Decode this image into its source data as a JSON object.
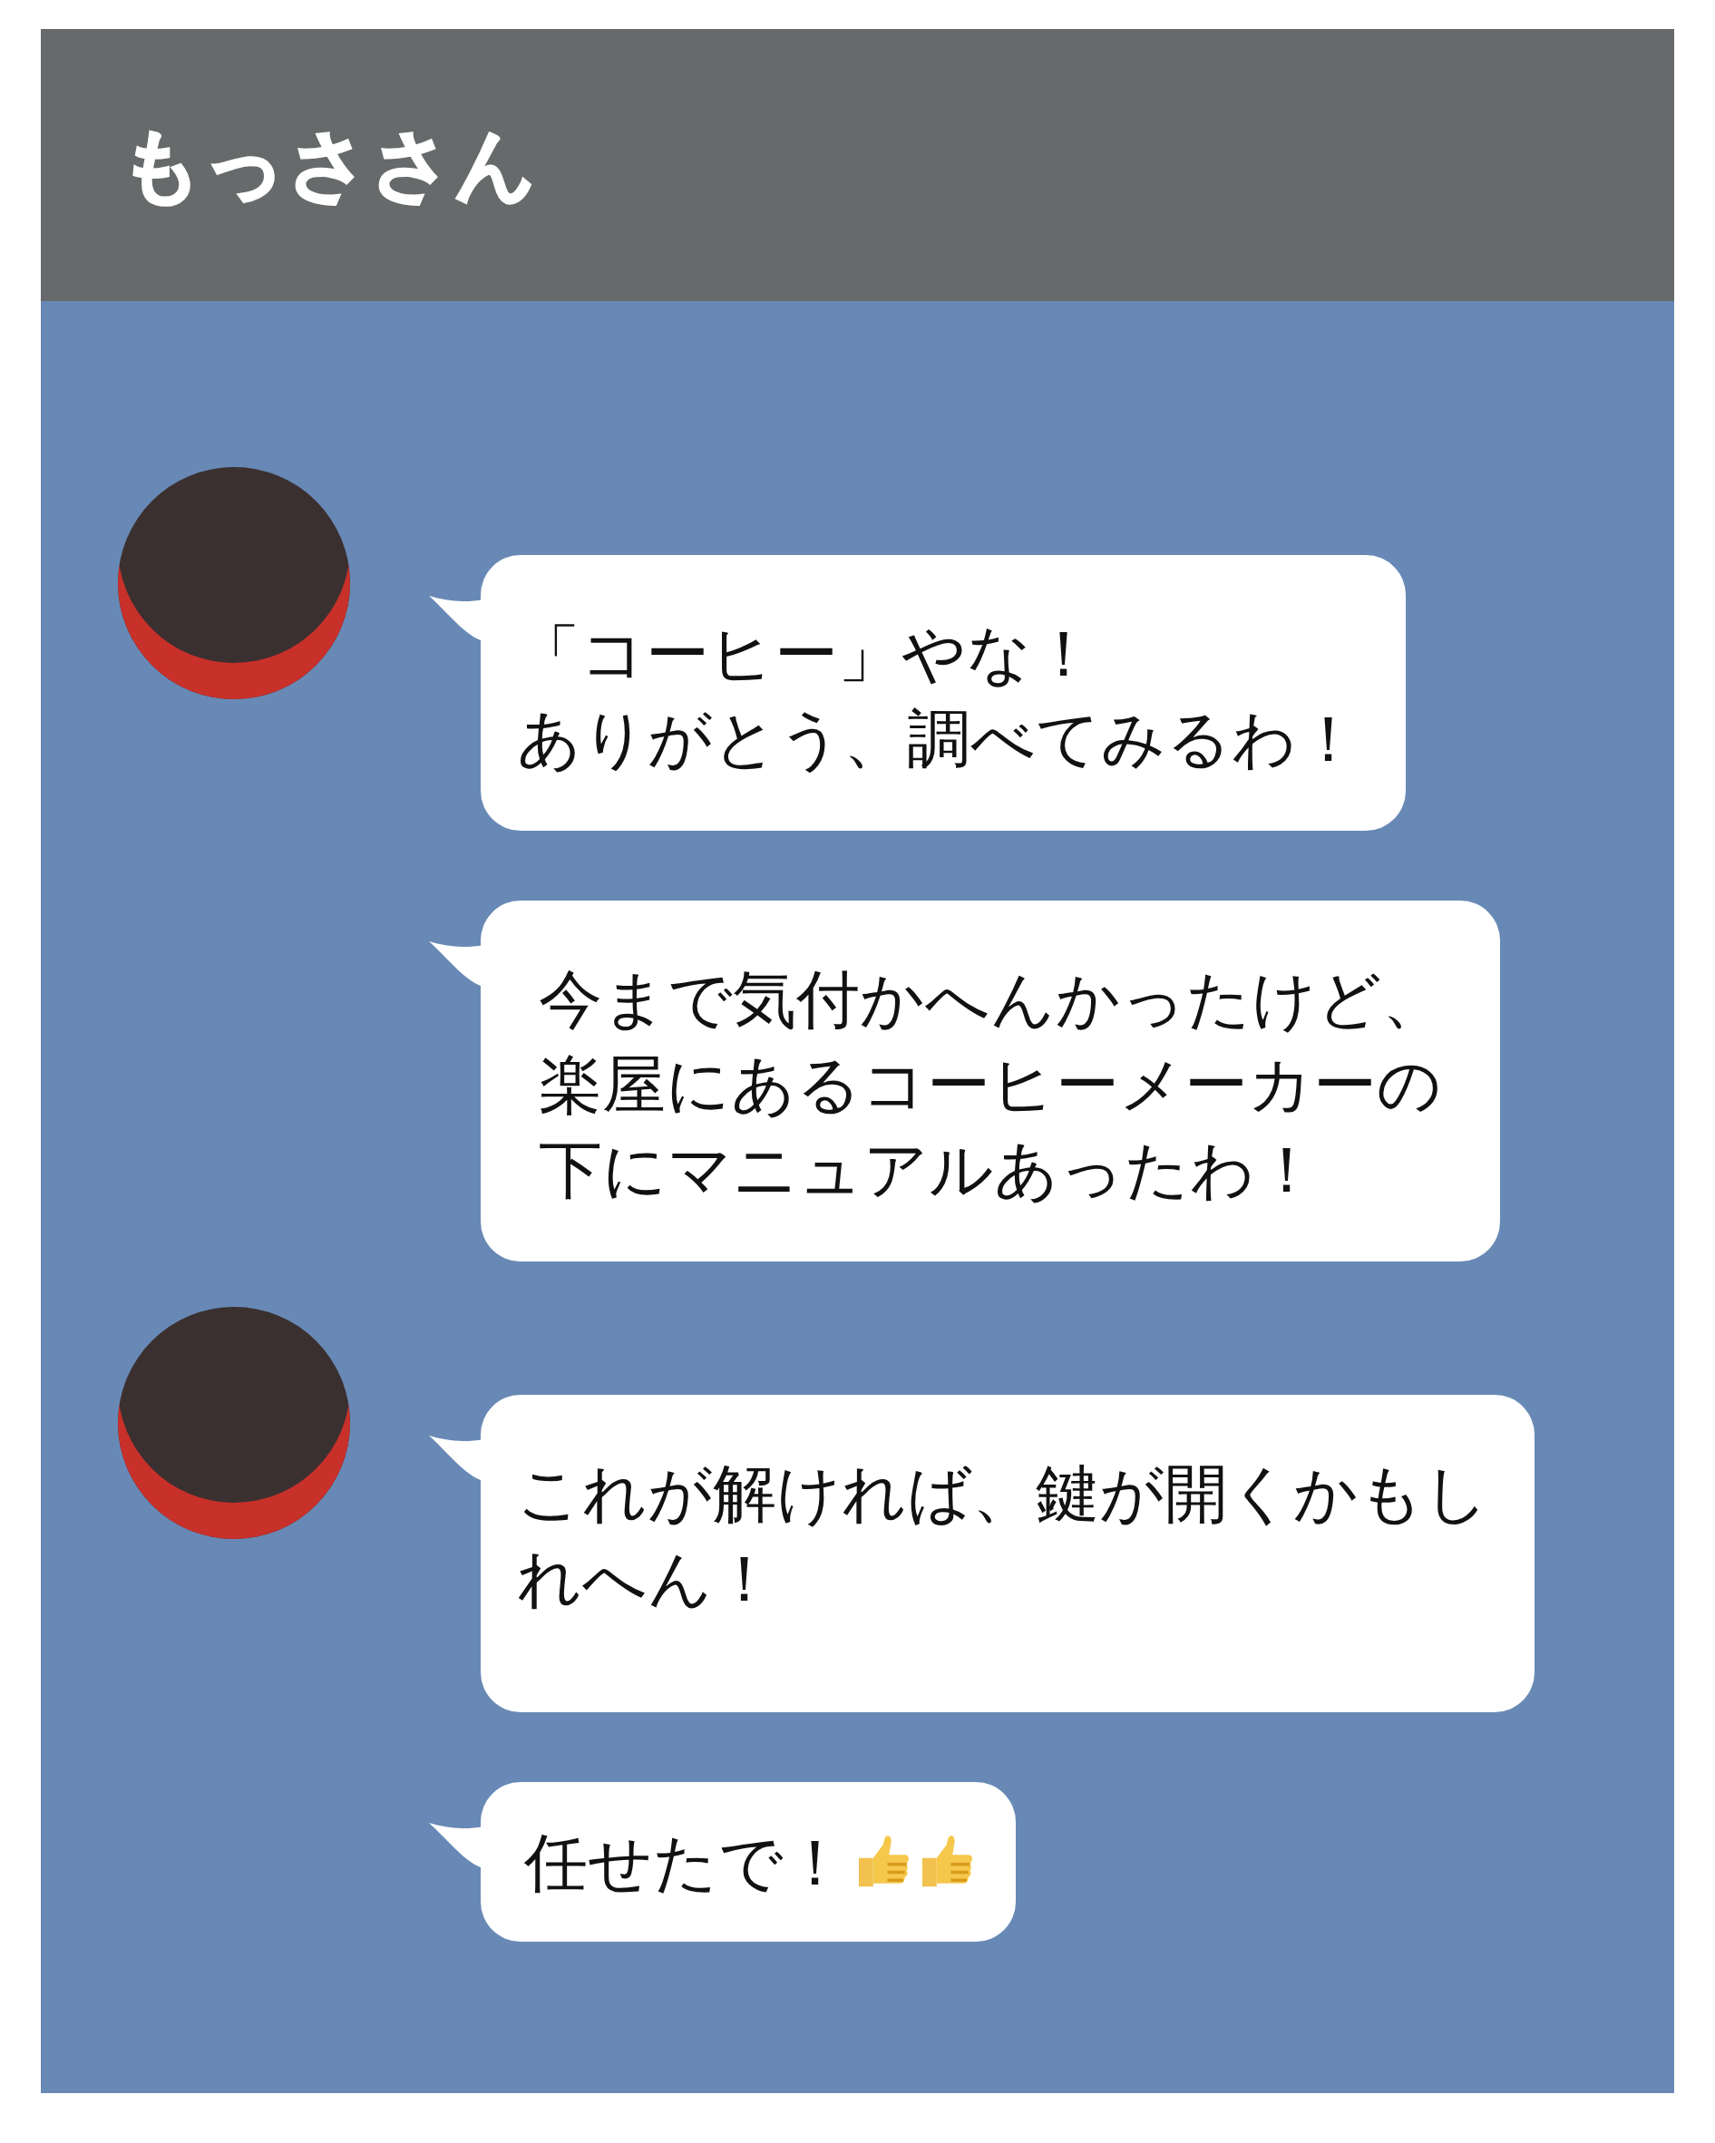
{
  "header": {
    "title": "もっささん"
  },
  "messages": [
    {
      "has_avatar": true,
      "lines": [
        "「コーヒー」やな！",
        "ありがとう、調べてみるわ！"
      ]
    },
    {
      "has_avatar": false,
      "lines": [
        "今まで気付かへんかったけど、",
        "楽屋にあるコーヒーメーカーの",
        "下にマニュアルあったわ！"
      ]
    },
    {
      "has_avatar": true,
      "lines": [
        "これが解ければ、鍵が開くかもし",
        "れへん！"
      ]
    },
    {
      "has_avatar": false,
      "lines": [
        "任せたで！"
      ],
      "icons": [
        {
          "kind": "thumbs-up"
        },
        {
          "kind": "thumbs-up"
        }
      ]
    }
  ]
}
